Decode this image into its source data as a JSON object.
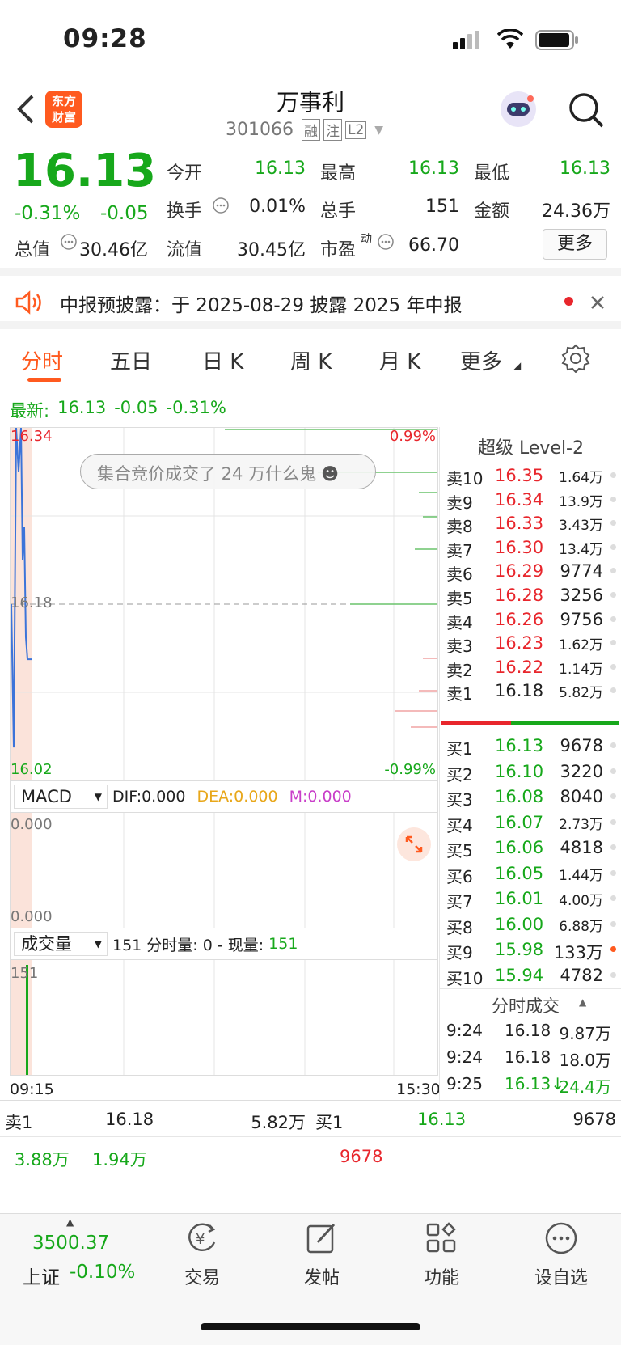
{
  "status_bar": {
    "time": "09:28"
  },
  "header": {
    "title": "万事利",
    "code": "301066",
    "tag_margin": "融",
    "tag_watch": "注",
    "tag_l2": "L2",
    "logo_line1": "东方",
    "logo_line2": "财富"
  },
  "quote": {
    "price": "16.13",
    "change_pct": "-0.31%",
    "change": "-0.05",
    "open_label": "今开",
    "open": "16.13",
    "high_label": "最高",
    "high": "16.13",
    "low_label": "最低",
    "low": "16.13",
    "turnover_label": "换手",
    "turnover": "0.01%",
    "vol_label": "总手",
    "vol": "151",
    "amount_label": "金额",
    "amount": "24.36万",
    "mcap_label": "总值",
    "mcap": "30.46亿",
    "float_label": "流值",
    "float": "30.45亿",
    "pe_label": "市盈",
    "pe_sup": "动",
    "pe": "66.70",
    "more": "更多"
  },
  "notice": {
    "text": "中报预披露：于 2025-08-29 披露 2025 年中报"
  },
  "tabs": [
    "分时",
    "五日",
    "日 K",
    "周 K",
    "月 K",
    "更多"
  ],
  "latest": {
    "label": "最新:",
    "price": "16.13",
    "change": "-0.05",
    "pct": "-0.31%"
  },
  "chart": {
    "top_price": "16.34",
    "top_pct": "0.99%",
    "mid_price": "16.18",
    "bottom_price": "16.02",
    "bottom_pct": "-0.99%",
    "bubble": "集合竞价成交了 24 万什么鬼",
    "macd_label": "MACD",
    "dif": "DIF:0.000",
    "dea": "DEA:0.000",
    "m": "M:0.000",
    "macd_top": "0.000",
    "macd_bottom": "0.000",
    "vol_label": "成交量",
    "vol_info": "151 分时量: 0 - 现量:",
    "vol_now": "151",
    "vol_axis": "151",
    "t_start": "09:15",
    "t_end": "15:30"
  },
  "chart_data": {
    "type": "line",
    "x": [
      "09:15",
      "09:24",
      "09:25"
    ],
    "y": [
      16.18,
      16.18,
      16.13
    ],
    "ylim": [
      16.02,
      16.34
    ],
    "volume": [
      151
    ]
  },
  "orderbook": {
    "title": "超级 Level-2",
    "asks": [
      {
        "l": "卖10",
        "p": "16.35",
        "v": "1.64万"
      },
      {
        "l": "卖9",
        "p": "16.34",
        "v": "13.9万"
      },
      {
        "l": "卖8",
        "p": "16.33",
        "v": "3.43万"
      },
      {
        "l": "卖7",
        "p": "16.30",
        "v": "13.4万"
      },
      {
        "l": "卖6",
        "p": "16.29",
        "v": "9774"
      },
      {
        "l": "卖5",
        "p": "16.28",
        "v": "3256"
      },
      {
        "l": "卖4",
        "p": "16.26",
        "v": "9756"
      },
      {
        "l": "卖3",
        "p": "16.23",
        "v": "1.62万"
      },
      {
        "l": "卖2",
        "p": "16.22",
        "v": "1.14万"
      },
      {
        "l": "卖1",
        "p": "16.18",
        "v": "5.82万"
      }
    ],
    "bids": [
      {
        "l": "买1",
        "p": "16.13",
        "v": "9678"
      },
      {
        "l": "买2",
        "p": "16.10",
        "v": "3220"
      },
      {
        "l": "买3",
        "p": "16.08",
        "v": "8040"
      },
      {
        "l": "买4",
        "p": "16.07",
        "v": "2.73万"
      },
      {
        "l": "买5",
        "p": "16.06",
        "v": "4818"
      },
      {
        "l": "买6",
        "p": "16.05",
        "v": "1.44万"
      },
      {
        "l": "买7",
        "p": "16.01",
        "v": "4.00万"
      },
      {
        "l": "买8",
        "p": "16.00",
        "v": "6.88万"
      },
      {
        "l": "买9",
        "p": "15.98",
        "v": "133万"
      },
      {
        "l": "买10",
        "p": "15.94",
        "v": "4782"
      }
    ],
    "trades_title": "分时成交",
    "trades": [
      {
        "t": "9:24",
        "p": "16.18",
        "v": "9.87万"
      },
      {
        "t": "9:24",
        "p": "16.18",
        "v": "18.0万"
      },
      {
        "t": "9:25",
        "p": "16.13↓",
        "v": "24.4万"
      }
    ]
  },
  "queue": {
    "ask_label": "卖1",
    "ask_price": "16.18",
    "ask_vol": "5.82万",
    "bid_label": "买1",
    "bid_price": "16.13",
    "bid_vol": "9678",
    "ask_q1": "3.88万",
    "ask_q2": "1.94万",
    "bid_q1": "9678"
  },
  "footer": {
    "index_value": "3500.37",
    "index_name": "上证",
    "index_pct": "-0.10%",
    "trade": "交易",
    "post": "发帖",
    "function": "功能",
    "watch": "设自选"
  }
}
